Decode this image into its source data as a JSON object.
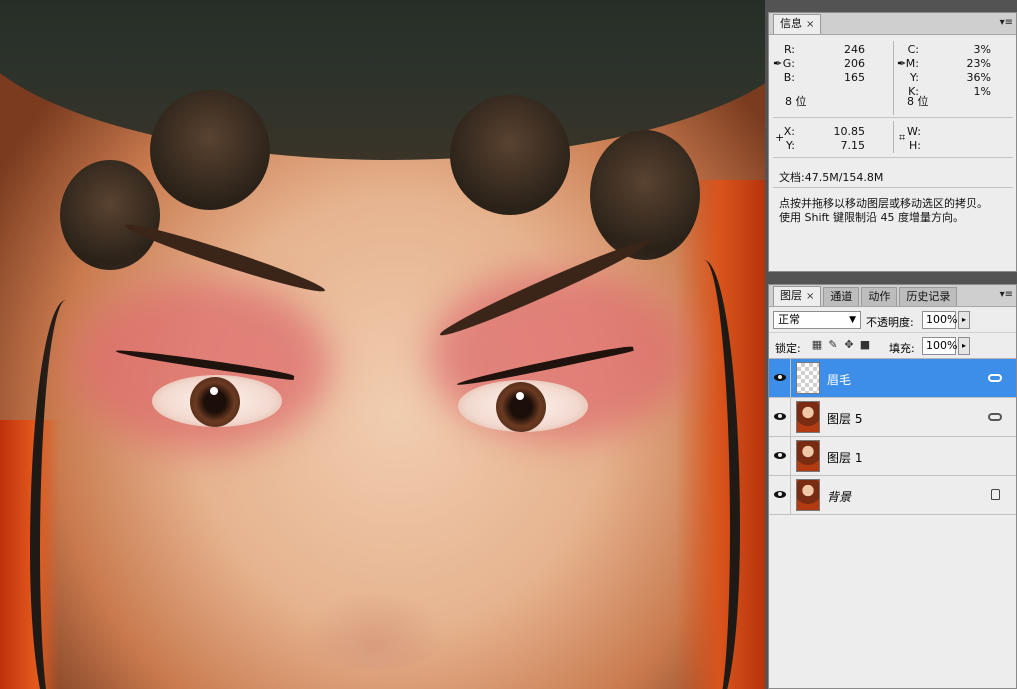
{
  "info_panel": {
    "tab_label": "信息",
    "close_glyph": "×",
    "rgb": {
      "r_label": "R:",
      "r": "246",
      "g_label": "G:",
      "g": "206",
      "b_label": "B:",
      "b": "165",
      "bits": "8 位"
    },
    "cmyk": {
      "c_label": "C:",
      "c": "3%",
      "m_label": "M:",
      "m": "23%",
      "y_label": "Y:",
      "y": "36%",
      "k_label": "K:",
      "k": "1%",
      "bits": "8 位"
    },
    "position": {
      "x_label": "X:",
      "x": "10.85",
      "y_label": "Y:",
      "y": "7.15"
    },
    "size": {
      "w_label": "W:",
      "h_label": "H:"
    },
    "doc_size": "文档:47.5M/154.8M",
    "hint_line1": "点按并拖移以移动图层或移动选区的拷贝。",
    "hint_line2": "使用 Shift 键限制沿 45 度增量方向。"
  },
  "layers_panel": {
    "tabs": [
      {
        "label": "图层",
        "active": true
      },
      {
        "label": "通道",
        "active": false
      },
      {
        "label": "动作",
        "active": false
      },
      {
        "label": "历史记录",
        "active": false
      }
    ],
    "close_glyph": "×",
    "blend_mode": "正常",
    "opacity_label": "不透明度:",
    "opacity_value": "100%",
    "lock_label": "锁定:",
    "fill_label": "填充:",
    "fill_value": "100%",
    "layers": [
      {
        "name": "眉毛",
        "selected": true,
        "thumb": "transparent",
        "badge": "link"
      },
      {
        "name": "图层 5",
        "selected": false,
        "thumb": "photo",
        "badge": "link"
      },
      {
        "name": "图层 1",
        "selected": false,
        "thumb": "photo",
        "badge": ""
      },
      {
        "name": "背景",
        "selected": false,
        "thumb": "photo",
        "badge": "lock",
        "italic": true
      }
    ]
  },
  "icons": {
    "eyedropper": "eyedropper-icon",
    "crosshair": "crosshair-icon",
    "selection_size": "selection-size-icon",
    "eye": "eye-icon",
    "link": "link-icon",
    "lock": "lock-icon",
    "panel_menu": "panel-menu-icon"
  },
  "colors": {
    "selection_blue": "#3d8ee8",
    "panel_bg": "#ededed",
    "panel_chrome": "#535353"
  }
}
